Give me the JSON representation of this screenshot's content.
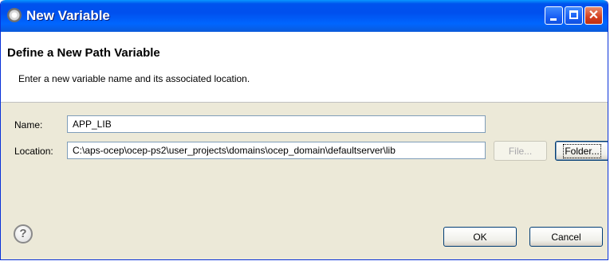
{
  "window": {
    "title": "New Variable",
    "controls": {
      "minimize_icon": "minimize-icon",
      "maximize_icon": "maximize-icon",
      "close_icon": "close-icon"
    }
  },
  "header": {
    "title": "Define a New Path Variable",
    "description": "Enter a new variable name and its associated location."
  },
  "form": {
    "name_label": "Name:",
    "name_value": "APP_LIB",
    "location_label": "Location:",
    "location_value": "C:\\aps-ocep\\ocep-ps2\\user_projects\\domains\\ocep_domain\\defaultserver\\lib",
    "file_button": "File...",
    "folder_button": "Folder..."
  },
  "footer": {
    "help_icon": "help-icon",
    "help_glyph": "?",
    "ok_button": "OK",
    "cancel_button": "Cancel"
  },
  "colors": {
    "titlebar": "#0054e3",
    "dialog_bg": "#ece9d8",
    "header_bg": "#ffffff",
    "field_border": "#7f9db9"
  }
}
